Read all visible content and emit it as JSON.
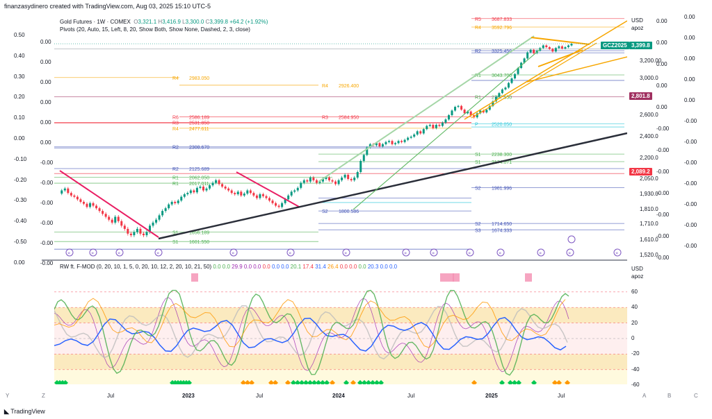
{
  "header": {
    "byline": "finanzasydinero created with TradingView.com, Aug 03, 2025 15:10 UTC-5"
  },
  "legend": {
    "symbol": "Gold Futures · 1W · COMEX",
    "o_label": "O",
    "o_value": "3,321.1",
    "h_label": "H",
    "h_value": "3,416.9",
    "l_label": "L",
    "l_value": "3,300.0",
    "c_label": "C",
    "c_value": "3,399.8",
    "change": "+64.2 (+1.92%)",
    "pivots": "Pivots (20, Auto, 15, Left, 8, 20, Show Both, Show None, Dashed, 2, 3, close)"
  },
  "osc_legend": {
    "name": "RW ft. F-MOD (0, 20, 10, 1, 5, 0, 20, 10, 12, 2, 20, 10, 21, 50)",
    "values": [
      {
        "v": "0.0",
        "c": "#4caf50"
      },
      {
        "v": "0.0",
        "c": "#4caf50"
      },
      {
        "v": "29.9",
        "c": "#9c27b0"
      },
      {
        "v": "0.0",
        "c": "#9c27b0"
      },
      {
        "v": "0.0",
        "c": "#9c27b0"
      },
      {
        "v": "0.0",
        "c": "#f23645"
      },
      {
        "v": "0.0",
        "c": "#2962ff"
      },
      {
        "v": "0.0",
        "c": "#2962ff"
      },
      {
        "v": "20.1",
        "c": "#4caf50"
      },
      {
        "v": "17.4",
        "c": "#f23645"
      },
      {
        "v": "31.4",
        "c": "#2962ff"
      },
      {
        "v": "26.4",
        "c": "#ff9800"
      },
      {
        "v": "0.0",
        "c": "#f23645"
      },
      {
        "v": "0.0",
        "c": "#f23645"
      },
      {
        "v": "0.0",
        "c": "#4caf50"
      },
      {
        "v": "20.3",
        "c": "#2962ff"
      },
      {
        "v": "0.0",
        "c": "#2962ff"
      },
      {
        "v": "0.0",
        "c": "#2962ff"
      }
    ]
  },
  "price_axis": {
    "currency": "USD",
    "mode": "apoz",
    "ticks": [
      {
        "label": "3,200.00",
        "price": 3200
      },
      {
        "label": "3,000.0",
        "price": 3000
      },
      {
        "label": "2,600.0",
        "price": 2600
      },
      {
        "label": "2,400.0",
        "price": 2400
      },
      {
        "label": "2,200.0",
        "price": 2200
      },
      {
        "label": "2,050.0",
        "price": 2050
      },
      {
        "label": "1,930.0",
        "price": 1930
      },
      {
        "label": "1,810.0",
        "price": 1810
      },
      {
        "label": "1,710.0",
        "price": 1710
      },
      {
        "label": "1,610.0",
        "price": 1610
      },
      {
        "label": "1,520.0",
        "price": 1520
      }
    ],
    "tags": [
      {
        "label": "GCZ2025",
        "color": "#089981"
      },
      {
        "label": "3,399.8",
        "color": "#089981"
      },
      {
        "label": "2,801.8",
        "color": "#a03060"
      },
      {
        "label": "2,089.2",
        "color": "#f23645"
      }
    ]
  },
  "left_scale": [
    "0.50",
    "0.40",
    "0.30",
    "0.20",
    "0.10",
    "0.00",
    "-0.10",
    "-0.20",
    "-0.30",
    "-0.40",
    "-0.50",
    "0.00"
  ],
  "left_scale_b": [
    "0.00",
    "0.00",
    "0.00",
    "0.00",
    "0.00",
    "0.00",
    "-0.00",
    "-0.00",
    "-0.00",
    "-0.00",
    "-0.00",
    "-0.00"
  ],
  "right_scale_a": [
    "0.00",
    "0.00",
    "0.00",
    "0.00",
    "0.00",
    "-0.00",
    "-0.00",
    "-0.00",
    "-0.00",
    "-0.00",
    "-0.00",
    "-0.00"
  ],
  "right_scale_b": [
    "0.00",
    "0.00",
    "0.00",
    "0.00",
    "0.00",
    "-0.00",
    "-0.00",
    "-0.00",
    "-0.00",
    "-0.00",
    "-0.00",
    "-0.00"
  ],
  "osc_axis": {
    "currency": "USD",
    "mode": "apoz",
    "ticks": [
      "60",
      "40",
      "20",
      "0",
      "-20",
      "-40",
      "-60"
    ]
  },
  "time_axis": {
    "labels": [
      "Jul",
      "2023",
      "Jul",
      "2024",
      "Jul",
      "2025",
      "Jul"
    ],
    "bottom_letters_left": [
      "Y",
      "Z"
    ],
    "bottom_letters_right": [
      "A",
      "B",
      "C"
    ]
  },
  "pivot_labels": [
    {
      "t": "R4",
      "v": "2983.050",
      "c": "#f7a600"
    },
    {
      "t": "R4",
      "v": "2926.400",
      "c": "#f7a600"
    },
    {
      "t": "R5",
      "v": "3687.833",
      "c": "#f23645"
    },
    {
      "t": "R4",
      "v": "3592.796",
      "c": "#f7a600"
    },
    {
      "t": "R2",
      "v": "3325.450",
      "c": "#3f51b5"
    },
    {
      "t": "R1",
      "v": "3043.700",
      "c": "#4caf50"
    },
    {
      "t": "R1",
      "v": "2787.550",
      "c": "#4caf50"
    },
    {
      "t": "R6",
      "v": "2586.189",
      "c": "#f23645"
    },
    {
      "t": "R3",
      "v": "2584.950",
      "c": "#f23645"
    },
    {
      "t": "R3",
      "v": "2531.850",
      "c": "#f23645"
    },
    {
      "t": "R4",
      "v": "2477.611",
      "c": "#f7a600"
    },
    {
      "t": "P",
      "v": "2520.050",
      "c": "#26c6da"
    },
    {
      "t": "R2",
      "v": "2308.670",
      "c": "#3f51b5"
    },
    {
      "t": "R2",
      "v": "2125.689",
      "c": "#3f51b5"
    },
    {
      "t": "R1",
      "v": "2062.050",
      "c": "#4caf50"
    },
    {
      "t": "R1",
      "v": "2017.011",
      "c": "#4caf50"
    },
    {
      "t": "S1",
      "v": "2238.300",
      "c": "#4caf50"
    },
    {
      "t": "S1",
      "v": "2174.071",
      "c": "#4caf50"
    },
    {
      "t": "S2",
      "v": "1981.996",
      "c": "#3f51b5"
    },
    {
      "t": "S2",
      "v": "1800.586",
      "c": "#3f51b5"
    },
    {
      "t": "S2",
      "v": "1714.650",
      "c": "#3f51b5"
    },
    {
      "t": "S3",
      "v": "1674.333",
      "c": "#3f51b5"
    },
    {
      "t": "S1",
      "v": "1601.550",
      "c": "#4caf50"
    },
    {
      "t": "S1",
      "v": "1656.189",
      "c": "#4caf50"
    }
  ],
  "footer": {
    "brand": "TradingView"
  }
}
